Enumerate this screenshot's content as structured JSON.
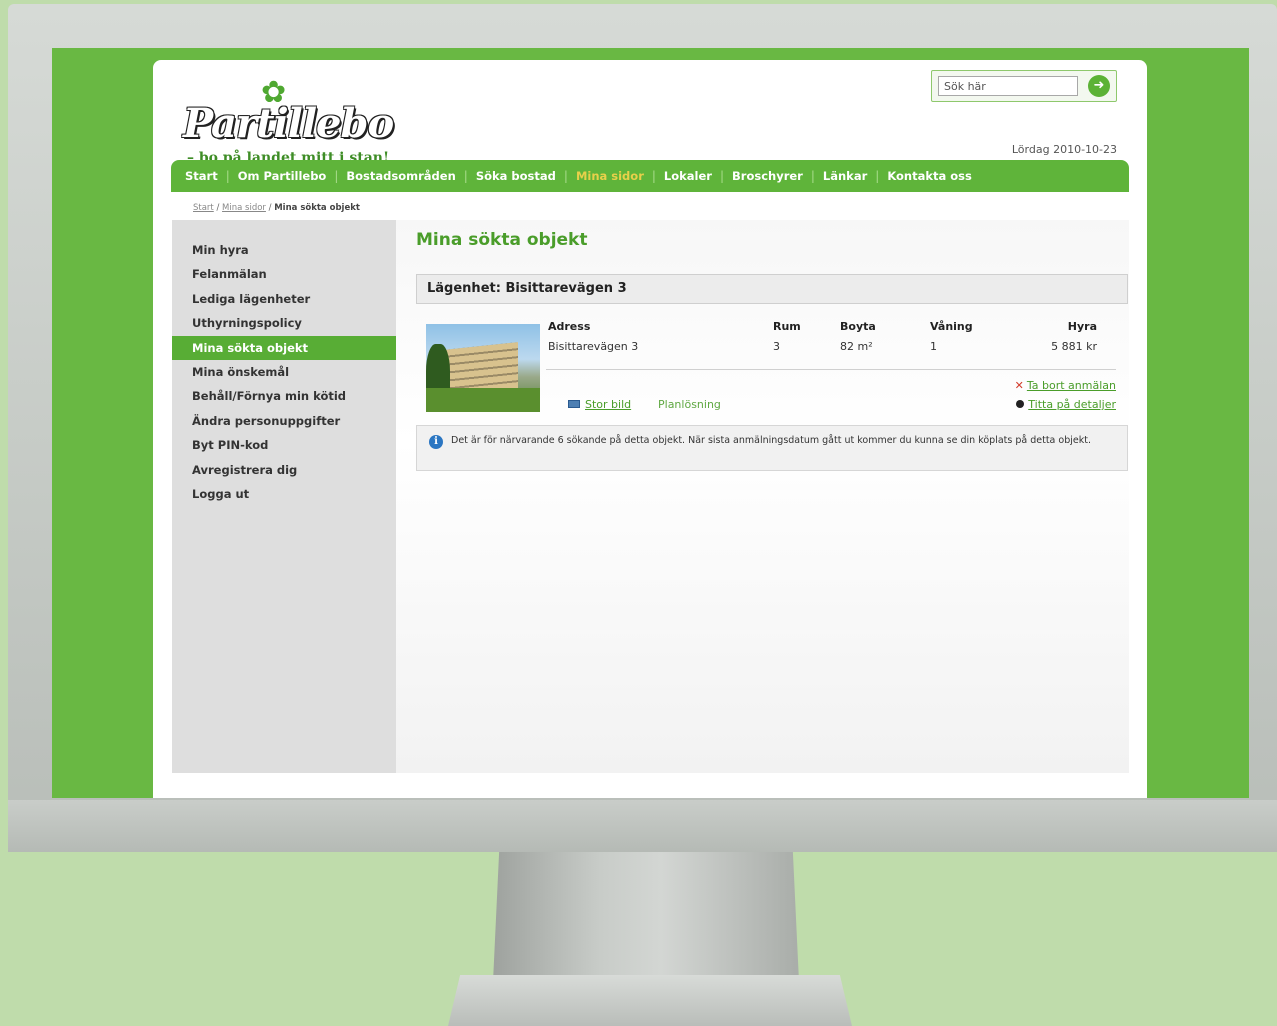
{
  "brand": {
    "name": "Partillebo",
    "tagline": "– bo på landet mitt i stan!"
  },
  "search": {
    "value": "Sök här",
    "button_icon": "arrow-right-icon"
  },
  "date": "Lördag 2010-10-23",
  "nav": {
    "items": [
      {
        "label": "Start"
      },
      {
        "label": "Om Partillebo"
      },
      {
        "label": "Bostadsområden"
      },
      {
        "label": "Söka bostad"
      },
      {
        "label": "Mina sidor"
      },
      {
        "label": "Lokaler"
      },
      {
        "label": "Broschyrer"
      },
      {
        "label": "Länkar"
      },
      {
        "label": "Kontakta oss"
      }
    ],
    "active_index": 4
  },
  "breadcrumb": {
    "items": [
      "Start",
      "Mina sidor",
      "Mina sökta objekt"
    ],
    "separator": "/"
  },
  "sidebar": {
    "items": [
      {
        "label": "Min hyra"
      },
      {
        "label": "Felanmälan"
      },
      {
        "label": "Lediga lägenheter"
      },
      {
        "label": "Uthyrningspolicy"
      },
      {
        "label": "Mina sökta objekt"
      },
      {
        "label": "Mina önskemål"
      },
      {
        "label": "Behåll/Förnya min kötid"
      },
      {
        "label": "Ändra personuppgifter"
      },
      {
        "label": "Byt PIN-kod"
      },
      {
        "label": "Avregistrera dig"
      },
      {
        "label": "Logga ut"
      }
    ],
    "active_index": 4
  },
  "content": {
    "title": "Mina sökta objekt",
    "object_header": "Lägenhet: Bisittarevägen 3",
    "columns": {
      "adress": "Adress",
      "rum": "Rum",
      "boyta": "Boyta",
      "vaning": "Våning",
      "hyra": "Hyra"
    },
    "values": {
      "adress": "Bisittarevägen 3",
      "rum": "3",
      "boyta": "82 m²",
      "vaning": "1",
      "hyra": "5 881 kr"
    },
    "actions": {
      "remove": "Ta bort anmälan",
      "details": "Titta på detaljer",
      "large_image": "Stor bild",
      "floor_plan": "Planlösning"
    },
    "info_text": "Det är för närvarande 6 sökande på detta objekt. När sista anmälningsdatum gått ut kommer du kunna se din köplats på detta objekt."
  },
  "colors": {
    "brand_green": "#5fb43a",
    "active_nav_text": "#e8d04a",
    "screen_green": "#69b843",
    "backdrop": "#bfdcab"
  }
}
